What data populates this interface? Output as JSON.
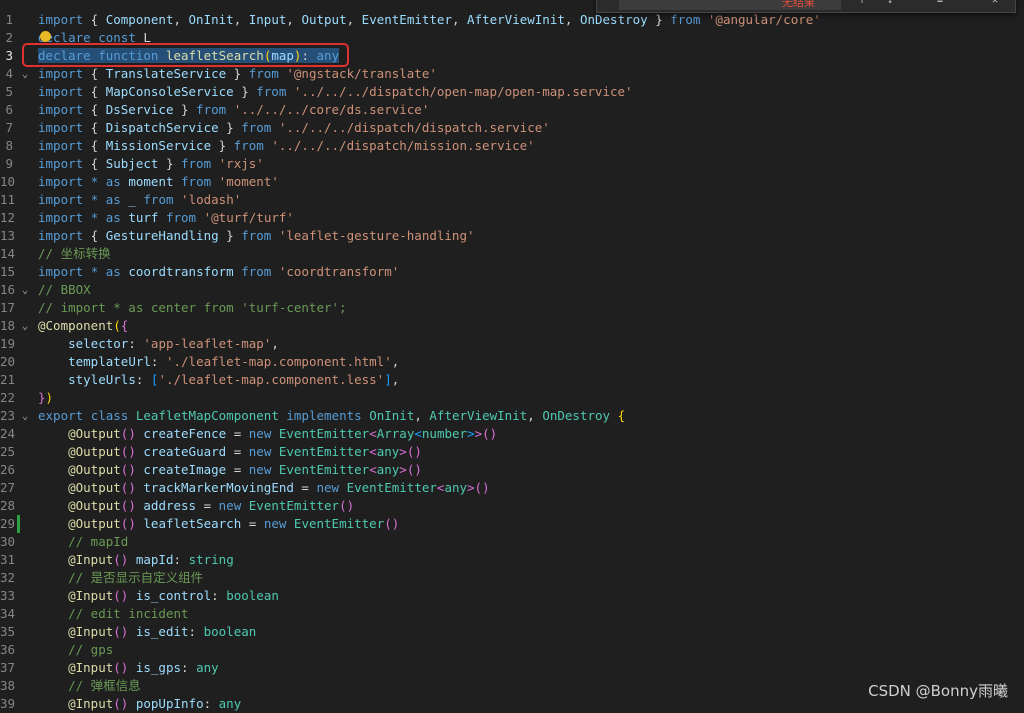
{
  "find_widget": {
    "status": "无结果"
  },
  "watermark": "CSDN @Bonny雨曦",
  "lines": [
    {
      "n": "1",
      "fold": "",
      "tokens": [
        [
          "kw2",
          "import"
        ],
        [
          "pun",
          " { "
        ],
        [
          "id",
          "Component"
        ],
        [
          "pun",
          ", "
        ],
        [
          "id",
          "OnInit"
        ],
        [
          "pun",
          ", "
        ],
        [
          "id",
          "Input"
        ],
        [
          "pun",
          ", "
        ],
        [
          "id",
          "Output"
        ],
        [
          "pun",
          ", "
        ],
        [
          "id",
          "EventEmitter"
        ],
        [
          "pun",
          ", "
        ],
        [
          "id",
          "AfterViewInit"
        ],
        [
          "pun",
          ", "
        ],
        [
          "id",
          "OnDestroy"
        ],
        [
          "pun",
          " } "
        ],
        [
          "kw2",
          "from"
        ],
        [
          "pun",
          " "
        ],
        [
          "str",
          "'@angular/core'"
        ]
      ]
    },
    {
      "n": "2",
      "fold": "",
      "tokens": [
        [
          "kw2",
          "declare"
        ],
        [
          "pun",
          " "
        ],
        [
          "kw2",
          "const"
        ],
        [
          "pun",
          " L"
        ]
      ]
    },
    {
      "n": "3",
      "fold": "",
      "active": true,
      "tokens": [
        [
          "kw2 sel",
          "declare"
        ],
        [
          "pun sel",
          " "
        ],
        [
          "kw2 sel",
          "function"
        ],
        [
          "pun sel",
          " "
        ],
        [
          "fn sel",
          "leafletSearch"
        ],
        [
          "br1 sel",
          "("
        ],
        [
          "id sel",
          "map"
        ],
        [
          "br1 sel",
          ")"
        ],
        [
          "pun sel",
          ": "
        ],
        [
          "kw2 sel",
          "any"
        ]
      ]
    },
    {
      "n": "4",
      "fold": "⌄",
      "tokens": [
        [
          "kw2",
          "import"
        ],
        [
          "pun",
          " { "
        ],
        [
          "id",
          "TranslateService"
        ],
        [
          "pun",
          " } "
        ],
        [
          "kw2",
          "from"
        ],
        [
          "pun",
          " "
        ],
        [
          "str",
          "'@ngstack/translate'"
        ]
      ]
    },
    {
      "n": "5",
      "fold": "",
      "tokens": [
        [
          "kw2",
          "import"
        ],
        [
          "pun",
          " { "
        ],
        [
          "id",
          "MapConsoleService"
        ],
        [
          "pun",
          " } "
        ],
        [
          "kw2",
          "from"
        ],
        [
          "pun",
          " "
        ],
        [
          "str",
          "'../../../dispatch/open-map/open-map.service'"
        ]
      ]
    },
    {
      "n": "6",
      "fold": "",
      "tokens": [
        [
          "kw2",
          "import"
        ],
        [
          "pun",
          " { "
        ],
        [
          "id",
          "DsService"
        ],
        [
          "pun",
          " } "
        ],
        [
          "kw2",
          "from"
        ],
        [
          "pun",
          " "
        ],
        [
          "str",
          "'../../../core/ds.service'"
        ]
      ]
    },
    {
      "n": "7",
      "fold": "",
      "tokens": [
        [
          "kw2",
          "import"
        ],
        [
          "pun",
          " { "
        ],
        [
          "id",
          "DispatchService"
        ],
        [
          "pun",
          " } "
        ],
        [
          "kw2",
          "from"
        ],
        [
          "pun",
          " "
        ],
        [
          "str",
          "'../../../dispatch/dispatch.service'"
        ]
      ]
    },
    {
      "n": "8",
      "fold": "",
      "tokens": [
        [
          "kw2",
          "import"
        ],
        [
          "pun",
          " { "
        ],
        [
          "id",
          "MissionService"
        ],
        [
          "pun",
          " } "
        ],
        [
          "kw2",
          "from"
        ],
        [
          "pun",
          " "
        ],
        [
          "str",
          "'../../../dispatch/mission.service'"
        ]
      ]
    },
    {
      "n": "9",
      "fold": "",
      "tokens": [
        [
          "kw2",
          "import"
        ],
        [
          "pun",
          " { "
        ],
        [
          "id",
          "Subject"
        ],
        [
          "pun",
          " } "
        ],
        [
          "kw2",
          "from"
        ],
        [
          "pun",
          " "
        ],
        [
          "str",
          "'rxjs'"
        ]
      ]
    },
    {
      "n": "10",
      "fold": "",
      "tokens": [
        [
          "kw2",
          "import"
        ],
        [
          "pun",
          " "
        ],
        [
          "kw2",
          "*"
        ],
        [
          "pun",
          " "
        ],
        [
          "kw2",
          "as"
        ],
        [
          "pun",
          " "
        ],
        [
          "id",
          "moment"
        ],
        [
          "pun",
          " "
        ],
        [
          "kw2",
          "from"
        ],
        [
          "pun",
          " "
        ],
        [
          "str",
          "'moment'"
        ]
      ]
    },
    {
      "n": "11",
      "fold": "",
      "tokens": [
        [
          "kw2",
          "import"
        ],
        [
          "pun",
          " "
        ],
        [
          "kw2",
          "*"
        ],
        [
          "pun",
          " "
        ],
        [
          "kw2",
          "as"
        ],
        [
          "pun",
          " "
        ],
        [
          "id",
          "_"
        ],
        [
          "pun",
          " "
        ],
        [
          "kw2",
          "from"
        ],
        [
          "pun",
          " "
        ],
        [
          "str",
          "'lodash'"
        ]
      ]
    },
    {
      "n": "12",
      "fold": "",
      "tokens": [
        [
          "kw2",
          "import"
        ],
        [
          "pun",
          " "
        ],
        [
          "kw2",
          "*"
        ],
        [
          "pun",
          " "
        ],
        [
          "kw2",
          "as"
        ],
        [
          "pun",
          " "
        ],
        [
          "id",
          "turf"
        ],
        [
          "pun",
          " "
        ],
        [
          "kw2",
          "from"
        ],
        [
          "pun",
          " "
        ],
        [
          "str",
          "'@turf/turf'"
        ]
      ]
    },
    {
      "n": "13",
      "fold": "",
      "tokens": [
        [
          "kw2",
          "import"
        ],
        [
          "pun",
          " { "
        ],
        [
          "id",
          "GestureHandling"
        ],
        [
          "pun",
          " } "
        ],
        [
          "kw2",
          "from"
        ],
        [
          "pun",
          " "
        ],
        [
          "str",
          "'leaflet-gesture-handling'"
        ]
      ]
    },
    {
      "n": "14",
      "fold": "",
      "tokens": [
        [
          "cm",
          "// 坐标转换"
        ]
      ]
    },
    {
      "n": "15",
      "fold": "",
      "tokens": [
        [
          "kw2",
          "import"
        ],
        [
          "pun",
          " "
        ],
        [
          "kw2",
          "*"
        ],
        [
          "pun",
          " "
        ],
        [
          "kw2",
          "as"
        ],
        [
          "pun",
          " "
        ],
        [
          "id",
          "coordtransform"
        ],
        [
          "pun",
          " "
        ],
        [
          "kw2",
          "from"
        ],
        [
          "pun",
          " "
        ],
        [
          "str",
          "'coordtransform'"
        ]
      ]
    },
    {
      "n": "16",
      "fold": "⌄",
      "tokens": [
        [
          "cm",
          "// BBOX"
        ]
      ]
    },
    {
      "n": "17",
      "fold": "",
      "tokens": [
        [
          "cm",
          "// import * as center from 'turf-center';"
        ]
      ]
    },
    {
      "n": "18",
      "fold": "⌄",
      "tokens": [
        [
          "dec",
          "@Component"
        ],
        [
          "br1",
          "("
        ],
        [
          "br2",
          "{"
        ]
      ]
    },
    {
      "n": "19",
      "fold": "",
      "tokens": [
        [
          "pun",
          "    "
        ],
        [
          "id",
          "selector"
        ],
        [
          "pun",
          ": "
        ],
        [
          "str",
          "'app-leaflet-map'"
        ],
        [
          "pun",
          ","
        ]
      ]
    },
    {
      "n": "20",
      "fold": "",
      "tokens": [
        [
          "pun",
          "    "
        ],
        [
          "id",
          "templateUrl"
        ],
        [
          "pun",
          ": "
        ],
        [
          "str",
          "'./leaflet-map.component.html'"
        ],
        [
          "pun",
          ","
        ]
      ]
    },
    {
      "n": "21",
      "fold": "",
      "tokens": [
        [
          "pun",
          "    "
        ],
        [
          "id",
          "styleUrls"
        ],
        [
          "pun",
          ": "
        ],
        [
          "br3",
          "["
        ],
        [
          "str",
          "'./leaflet-map.component.less'"
        ],
        [
          "br3",
          "]"
        ],
        [
          "pun",
          ","
        ]
      ]
    },
    {
      "n": "22",
      "fold": "",
      "tokens": [
        [
          "br2",
          "}"
        ],
        [
          "br1",
          ")"
        ]
      ]
    },
    {
      "n": "23",
      "fold": "⌄",
      "tokens": [
        [
          "kw2",
          "export"
        ],
        [
          "pun",
          " "
        ],
        [
          "kw2",
          "class"
        ],
        [
          "pun",
          " "
        ],
        [
          "cls",
          "LeafletMapComponent"
        ],
        [
          "pun",
          " "
        ],
        [
          "kw2",
          "implements"
        ],
        [
          "pun",
          " "
        ],
        [
          "cls",
          "OnInit"
        ],
        [
          "pun",
          ", "
        ],
        [
          "cls",
          "AfterViewInit"
        ],
        [
          "pun",
          ", "
        ],
        [
          "cls",
          "OnDestroy"
        ],
        [
          "pun",
          " "
        ],
        [
          "br1",
          "{"
        ]
      ]
    },
    {
      "n": "24",
      "fold": "",
      "tokens": [
        [
          "pun",
          "    "
        ],
        [
          "dec",
          "@Output"
        ],
        [
          "br2",
          "()"
        ],
        [
          "pun",
          " "
        ],
        [
          "id",
          "createFence"
        ],
        [
          "pun",
          " = "
        ],
        [
          "kw2",
          "new"
        ],
        [
          "pun",
          " "
        ],
        [
          "cls",
          "EventEmitter"
        ],
        [
          "br2",
          "<"
        ],
        [
          "cls",
          "Array"
        ],
        [
          "br3",
          "<"
        ],
        [
          "typ",
          "number"
        ],
        [
          "br3",
          ">"
        ],
        [
          "br2",
          ">"
        ],
        [
          "br2",
          "()"
        ]
      ]
    },
    {
      "n": "25",
      "fold": "",
      "tokens": [
        [
          "pun",
          "    "
        ],
        [
          "dec",
          "@Output"
        ],
        [
          "br2",
          "()"
        ],
        [
          "pun",
          " "
        ],
        [
          "id",
          "createGuard"
        ],
        [
          "pun",
          " = "
        ],
        [
          "kw2",
          "new"
        ],
        [
          "pun",
          " "
        ],
        [
          "cls",
          "EventEmitter"
        ],
        [
          "br2",
          "<"
        ],
        [
          "typ",
          "any"
        ],
        [
          "br2",
          ">()"
        ]
      ]
    },
    {
      "n": "26",
      "fold": "",
      "tokens": [
        [
          "pun",
          "    "
        ],
        [
          "dec",
          "@Output"
        ],
        [
          "br2",
          "()"
        ],
        [
          "pun",
          " "
        ],
        [
          "id",
          "createImage"
        ],
        [
          "pun",
          " = "
        ],
        [
          "kw2",
          "new"
        ],
        [
          "pun",
          " "
        ],
        [
          "cls",
          "EventEmitter"
        ],
        [
          "br2",
          "<"
        ],
        [
          "typ",
          "any"
        ],
        [
          "br2",
          ">()"
        ]
      ]
    },
    {
      "n": "27",
      "fold": "",
      "tokens": [
        [
          "pun",
          "    "
        ],
        [
          "dec",
          "@Output"
        ],
        [
          "br2",
          "()"
        ],
        [
          "pun",
          " "
        ],
        [
          "id",
          "trackMarkerMovingEnd"
        ],
        [
          "pun",
          " = "
        ],
        [
          "kw2",
          "new"
        ],
        [
          "pun",
          " "
        ],
        [
          "cls",
          "EventEmitter"
        ],
        [
          "br2",
          "<"
        ],
        [
          "typ",
          "any"
        ],
        [
          "br2",
          ">()"
        ]
      ]
    },
    {
      "n": "28",
      "fold": "",
      "tokens": [
        [
          "pun",
          "    "
        ],
        [
          "dec",
          "@Output"
        ],
        [
          "br2",
          "()"
        ],
        [
          "pun",
          " "
        ],
        [
          "id",
          "address"
        ],
        [
          "pun",
          " = "
        ],
        [
          "kw2",
          "new"
        ],
        [
          "pun",
          " "
        ],
        [
          "cls",
          "EventEmitter"
        ],
        [
          "br2",
          "()"
        ]
      ]
    },
    {
      "n": "29",
      "fold": "",
      "mod": true,
      "tokens": [
        [
          "pun",
          "    "
        ],
        [
          "dec",
          "@Output"
        ],
        [
          "br2",
          "()"
        ],
        [
          "pun",
          " "
        ],
        [
          "id",
          "leafletSearch"
        ],
        [
          "pun",
          " = "
        ],
        [
          "kw2",
          "new"
        ],
        [
          "pun",
          " "
        ],
        [
          "cls",
          "EventEmitter"
        ],
        [
          "br2",
          "()"
        ]
      ]
    },
    {
      "n": "30",
      "fold": "",
      "tokens": [
        [
          "pun",
          "    "
        ],
        [
          "cm",
          "// mapId"
        ]
      ]
    },
    {
      "n": "31",
      "fold": "",
      "tokens": [
        [
          "pun",
          "    "
        ],
        [
          "dec",
          "@Input"
        ],
        [
          "br2",
          "()"
        ],
        [
          "pun",
          " "
        ],
        [
          "id",
          "mapId"
        ],
        [
          "pun",
          ": "
        ],
        [
          "typ",
          "string"
        ]
      ]
    },
    {
      "n": "32",
      "fold": "",
      "tokens": [
        [
          "pun",
          "    "
        ],
        [
          "cm",
          "// 是否显示自定义组件"
        ]
      ]
    },
    {
      "n": "33",
      "fold": "",
      "tokens": [
        [
          "pun",
          "    "
        ],
        [
          "dec",
          "@Input"
        ],
        [
          "br2",
          "()"
        ],
        [
          "pun",
          " "
        ],
        [
          "id",
          "is_control"
        ],
        [
          "pun",
          ": "
        ],
        [
          "typ",
          "boolean"
        ]
      ]
    },
    {
      "n": "34",
      "fold": "",
      "tokens": [
        [
          "pun",
          "    "
        ],
        [
          "cm",
          "// edit incident"
        ]
      ]
    },
    {
      "n": "35",
      "fold": "",
      "tokens": [
        [
          "pun",
          "    "
        ],
        [
          "dec",
          "@Input"
        ],
        [
          "br2",
          "()"
        ],
        [
          "pun",
          " "
        ],
        [
          "id",
          "is_edit"
        ],
        [
          "pun",
          ": "
        ],
        [
          "typ",
          "boolean"
        ]
      ]
    },
    {
      "n": "36",
      "fold": "",
      "tokens": [
        [
          "pun",
          "    "
        ],
        [
          "cm",
          "// gps"
        ]
      ]
    },
    {
      "n": "37",
      "fold": "",
      "tokens": [
        [
          "pun",
          "    "
        ],
        [
          "dec",
          "@Input"
        ],
        [
          "br2",
          "()"
        ],
        [
          "pun",
          " "
        ],
        [
          "id",
          "is_gps"
        ],
        [
          "pun",
          ": "
        ],
        [
          "typ",
          "any"
        ]
      ]
    },
    {
      "n": "38",
      "fold": "",
      "tokens": [
        [
          "pun",
          "    "
        ],
        [
          "cm",
          "// 弹框信息"
        ]
      ]
    },
    {
      "n": "39",
      "fold": "",
      "tokens": [
        [
          "pun",
          "    "
        ],
        [
          "dec",
          "@Input"
        ],
        [
          "br2",
          "()"
        ],
        [
          "pun",
          " "
        ],
        [
          "id",
          "popUpInfo"
        ],
        [
          "pun",
          ": "
        ],
        [
          "typ",
          "any"
        ]
      ]
    }
  ]
}
